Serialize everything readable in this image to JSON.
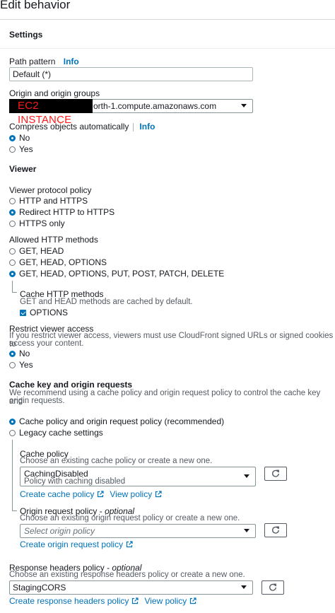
{
  "page": {
    "title": "Edit behavior"
  },
  "settings": {
    "header": "Settings",
    "path_pattern": {
      "label": "Path pattern",
      "info": "Info",
      "value": "Default (*)"
    },
    "origin": {
      "label": "Origin and origin groups",
      "redacted_text": "EC2 INSTANCE",
      "value": "orth-1.compute.amazonaws.com"
    },
    "compress": {
      "label": "Compress objects automatically",
      "info": "Info",
      "options": [
        "No",
        "Yes"
      ],
      "selected": "No"
    }
  },
  "viewer": {
    "header": "Viewer",
    "protocol_policy": {
      "label": "Viewer protocol policy",
      "options": [
        "HTTP and HTTPS",
        "Redirect HTTP to HTTPS",
        "HTTPS only"
      ],
      "selected": "Redirect HTTP to HTTPS"
    },
    "allowed_methods": {
      "label": "Allowed HTTP methods",
      "options": [
        "GET, HEAD",
        "GET, HEAD, OPTIONS",
        "GET, HEAD, OPTIONS, PUT, POST, PATCH, DELETE"
      ],
      "selected": "GET, HEAD, OPTIONS, PUT, POST, PATCH, DELETE"
    },
    "cache_methods": {
      "label": "Cache HTTP methods",
      "description": "GET and HEAD methods are cached by default.",
      "option": "OPTIONS",
      "checked": true
    },
    "restrict_access": {
      "label": "Restrict viewer access",
      "description_line1": "If you restrict viewer access, viewers must use CloudFront signed URLs or signed cookies to",
      "description_line2": "access your content.",
      "options": [
        "No",
        "Yes"
      ],
      "selected": "No"
    }
  },
  "cache_key": {
    "header": "Cache key and origin requests",
    "description_line1": "We recommend using a cache policy and origin request policy to control the cache key and",
    "description_line2": "origin requests.",
    "options": [
      "Cache policy and origin request policy (recommended)",
      "Legacy cache settings"
    ],
    "selected": "Cache policy and origin request policy (recommended)",
    "cache_policy": {
      "label": "Cache policy",
      "description": "Choose an existing cache policy or create a new one.",
      "value": "CachingDisabled",
      "value_sub": "Policy with caching disabled",
      "create_link": "Create cache policy",
      "view_link": "View policy"
    },
    "origin_request_policy": {
      "label": "Origin request policy",
      "label_suffix": "optional",
      "description": "Choose an existing origin request policy or create a new one.",
      "placeholder": "Select origin policy",
      "create_link": "Create origin request policy"
    }
  },
  "response_headers": {
    "label": "Response headers policy",
    "label_suffix": "optional",
    "description": "Choose an existing response headers policy or create a new one.",
    "value": "StagingCORS",
    "create_link": "Create response headers policy",
    "view_link": "View policy"
  },
  "colors": {
    "link": "#0073bb",
    "text": "#16191f",
    "muted": "#545b64",
    "redaction_text": "#ff1a1a"
  },
  "icons": [
    "external-link-icon",
    "refresh-icon",
    "chevron-down-icon"
  ]
}
